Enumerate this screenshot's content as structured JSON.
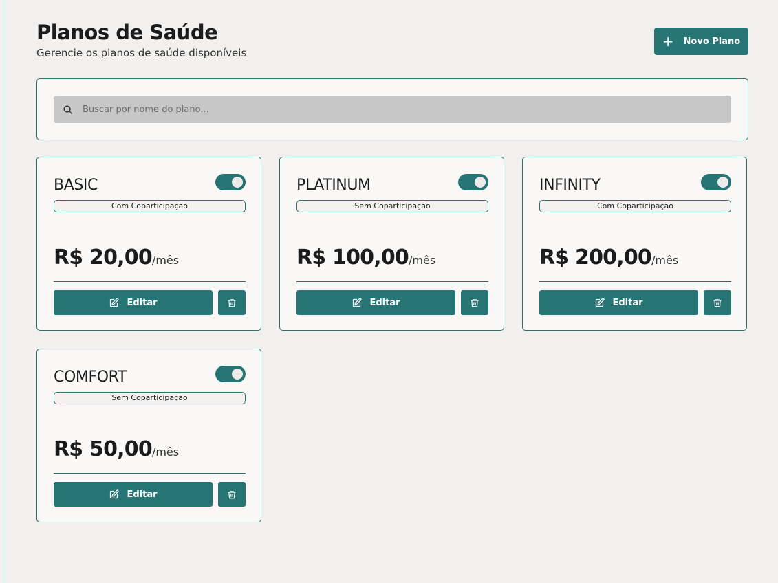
{
  "header": {
    "title": "Planos de Saúde",
    "subtitle": "Gerencie os planos de saúde disponíveis",
    "new_button_label": "Novo Plano"
  },
  "search": {
    "placeholder": "Buscar por nome do plano...",
    "value": ""
  },
  "plans": [
    {
      "name": "BASIC",
      "badge": "Com Coparticipação",
      "price": "R$ 20,00",
      "period": "/mês",
      "active": true,
      "edit_label": "Editar"
    },
    {
      "name": "PLATINUM",
      "badge": "Sem Coparticipação",
      "price": "R$ 100,00",
      "period": "/mês",
      "active": true,
      "edit_label": "Editar"
    },
    {
      "name": "INFINITY",
      "badge": "Com Coparticipação",
      "price": "R$ 200,00",
      "period": "/mês",
      "active": true,
      "edit_label": "Editar"
    },
    {
      "name": "COMFORT",
      "badge": "Sem Coparticipação",
      "price": "R$ 50,00",
      "period": "/mês",
      "active": true,
      "edit_label": "Editar"
    }
  ],
  "icons": {
    "new": "plus-icon",
    "search": "search-icon",
    "edit": "edit-icon",
    "delete": "trash-icon"
  },
  "colors": {
    "accent": "#267474",
    "background": "#f1f0ee",
    "card": "#f9f8f6",
    "search_field": "#c7c7c7"
  }
}
